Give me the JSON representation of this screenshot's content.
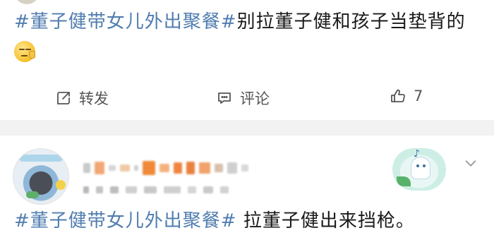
{
  "post": {
    "topic": "#董子健带女儿外出聚餐#",
    "text": "别拉董子健和孩子当垫背的",
    "emoji_icon": "shy-face-emoji"
  },
  "actions": {
    "repost": {
      "icon": "repost-icon",
      "label": "转发"
    },
    "comment": {
      "icon": "comment-icon",
      "label": "评论"
    },
    "like": {
      "icon": "thumbs-up-icon",
      "count": "7"
    }
  },
  "comment": {
    "topic": "#董子健带女儿外出聚餐#",
    "text": " 拉董子健出来挡枪。",
    "avatar_icon": "user-avatar",
    "badge_icon": "ghost-sticker-badge",
    "menu_icon": "chevron-down-icon"
  },
  "colors": {
    "topic": "#507daf",
    "text": "#1a1a1a",
    "separator": "#f2f2f2",
    "action": "#555555"
  }
}
